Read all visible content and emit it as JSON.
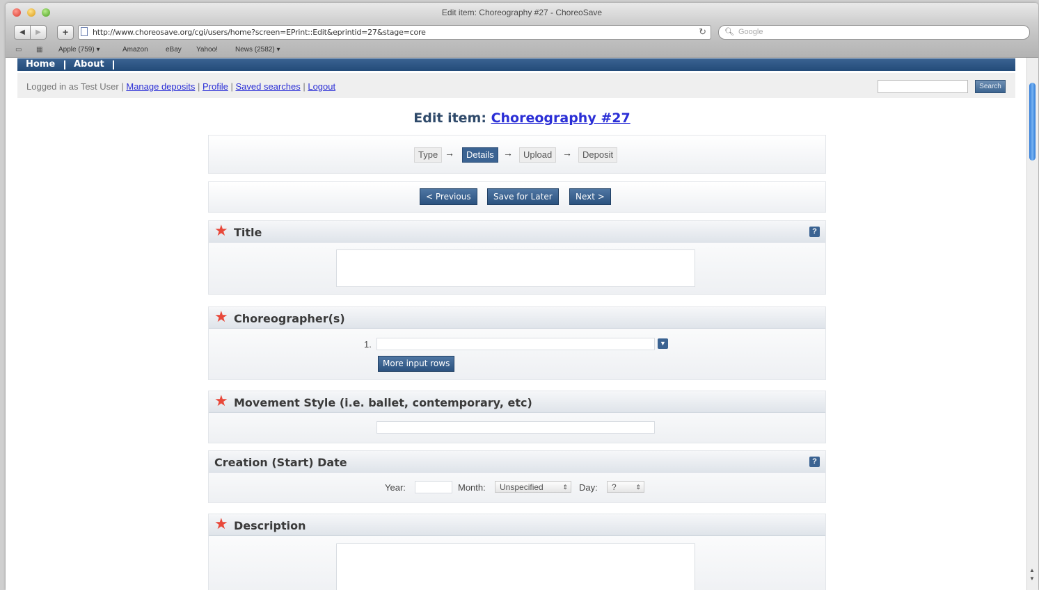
{
  "browser": {
    "window_title": "Edit item: Choreography #27 - ChoreoSave",
    "url": "http://www.choreosave.org/cgi/users/home?screen=EPrint::Edit&eprintid=27&stage=core",
    "search_placeholder": "Google",
    "bookmarks": [
      "Apple (759) ▾",
      "Amazon",
      "eBay",
      "Yahoo!",
      "News (2582) ▾"
    ]
  },
  "topnav": {
    "home": "Home",
    "about": "About"
  },
  "userbar": {
    "logged_in": "Logged in as Test User",
    "links": [
      "Manage deposits",
      "Profile",
      "Saved searches",
      "Logout"
    ],
    "search_button": "Search"
  },
  "page": {
    "title_prefix": "Edit item:",
    "title_link": "Choreography #27"
  },
  "steps": [
    "Type",
    "Details",
    "Upload",
    "Deposit"
  ],
  "active_step": "Details",
  "buttons": {
    "previous": "< Previous",
    "save_later": "Save for Later",
    "next": "Next >"
  },
  "sections": {
    "title": {
      "label": "Title",
      "required": true
    },
    "choreographers": {
      "label": "Choreographer(s)",
      "required": true,
      "row_number": "1.",
      "more_rows": "More input rows"
    },
    "movement_style": {
      "label": "Movement Style (i.e. ballet, contemporary, etc)",
      "required": true
    },
    "creation_date": {
      "label": "Creation (Start) Date",
      "year_label": "Year:",
      "month_label": "Month:",
      "month_value": "Unspecified",
      "day_label": "Day:",
      "day_value": "?"
    },
    "description": {
      "label": "Description",
      "required": true
    }
  },
  "colors": {
    "nav_blue": "#2f5785",
    "link_blue": "#2b2fd6",
    "required_star": "#e8483a"
  }
}
